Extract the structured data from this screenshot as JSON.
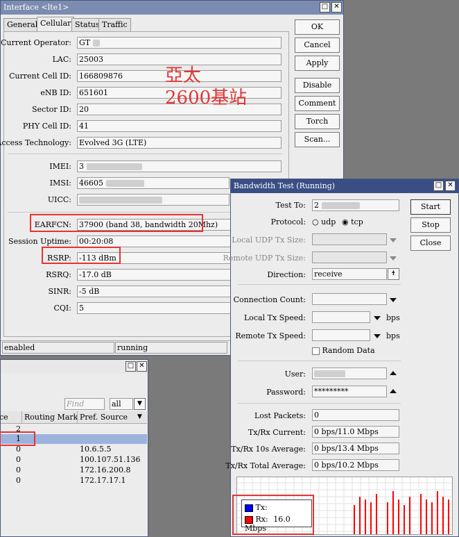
{
  "interface_window": {
    "title": "Interface <lte1>",
    "tabs": [
      "General",
      "Cellular",
      "Status",
      "Traffic"
    ],
    "buttons": [
      "OK",
      "Cancel",
      "Apply",
      "Disable",
      "Comment",
      "Torch",
      "Scan..."
    ],
    "fields": {
      "current_operator": {
        "label": "Current Operator:",
        "value": "GT"
      },
      "lac": {
        "label": "LAC:",
        "value": "25003"
      },
      "cell_id": {
        "label": "Current Cell ID:",
        "value": "166809876"
      },
      "enb_id": {
        "label": "eNB ID:",
        "value": "651601"
      },
      "sector_id": {
        "label": "Sector ID:",
        "value": "20"
      },
      "phy_cell_id": {
        "label": "PHY Cell ID:",
        "value": "41"
      },
      "access_tech": {
        "label": "Access Technology:",
        "value": "Evolved 3G (LTE)"
      },
      "imei": {
        "label": "IMEI:",
        "value": "3"
      },
      "imsi": {
        "label": "IMSI:",
        "value": "46605"
      },
      "uicc": {
        "label": "UICC:",
        "value": ""
      },
      "earfcn": {
        "label": "EARFCN:",
        "value": "37900 (band 38, bandwidth 20Mhz)"
      },
      "session_uptime": {
        "label": "Session Uptime:",
        "value": "00:20:08"
      },
      "rsrp": {
        "label": "RSRP:",
        "value": "-113 dBm"
      },
      "rsrq": {
        "label": "RSRQ:",
        "value": "-17.0 dB"
      },
      "sinr": {
        "label": "SINR:",
        "value": "-5 dB"
      },
      "cqi": {
        "label": "CQI:",
        "value": "5"
      }
    },
    "annotation_line1": "亞太",
    "annotation_line2": "2600基站",
    "status_bar": [
      "enabled",
      "running"
    ]
  },
  "route_window": {
    "find_placeholder": "Find",
    "filter_value": "all",
    "columns": [
      "ce",
      "Routing Mark",
      "Pref. Source"
    ],
    "rows": [
      {
        "dist": "2",
        "mark": "",
        "src": ""
      },
      {
        "dist": "1",
        "mark": "",
        "src": ""
      },
      {
        "dist": "0",
        "mark": "",
        "src": "10.6.5.5"
      },
      {
        "dist": "0",
        "mark": "",
        "src": "100.107.51.136"
      },
      {
        "dist": "0",
        "mark": "",
        "src": "172.16.200.8"
      },
      {
        "dist": "0",
        "mark": "",
        "src": "172.17.17.1"
      }
    ]
  },
  "bw_window": {
    "title": "Bandwidth Test (Running)",
    "buttons": [
      "Start",
      "Stop",
      "Close"
    ],
    "test_to": {
      "label": "Test To:",
      "value": "2"
    },
    "protocol": {
      "label": "Protocol:",
      "options": [
        "udp",
        "tcp"
      ],
      "selected": "tcp"
    },
    "local_udp": {
      "label": "Local UDP Tx Size:",
      "value": ""
    },
    "remote_udp": {
      "label": "Remote UDP Tx Size:",
      "value": ""
    },
    "direction": {
      "label": "Direction:",
      "value": "receive"
    },
    "conn_count": {
      "label": "Connection Count:",
      "value": ""
    },
    "local_tx": {
      "label": "Local Tx Speed:",
      "value": "",
      "unit": "bps"
    },
    "remote_tx": {
      "label": "Remote Tx Speed:",
      "value": "",
      "unit": "bps"
    },
    "random_data": "Random Data",
    "user": {
      "label": "User:",
      "value": ""
    },
    "password": {
      "label": "Password:",
      "value": "*********"
    },
    "lost_packets": {
      "label": "Lost Packets:",
      "value": "0"
    },
    "txrx_current": {
      "label": "Tx/Rx Current:",
      "value": "0 bps/11.0 Mbps"
    },
    "txrx_10s": {
      "label": "Tx/Rx 10s Average:",
      "value": "0 bps/13.4 Mbps"
    },
    "txrx_total": {
      "label": "Tx/Rx Total Average:",
      "value": "0 bps/10.2 Mbps"
    },
    "legend_tx": "Tx:",
    "legend_rx": "Rx:",
    "legend_rx_value": "16.0 Mbps",
    "colors": {
      "tx": "#0000ff",
      "rx": "#ff0000"
    }
  },
  "graph_values": [
    11,
    14,
    13,
    12,
    15,
    0,
    12,
    16,
    13,
    11,
    14,
    0,
    15,
    13,
    12,
    16,
    14,
    13
  ]
}
